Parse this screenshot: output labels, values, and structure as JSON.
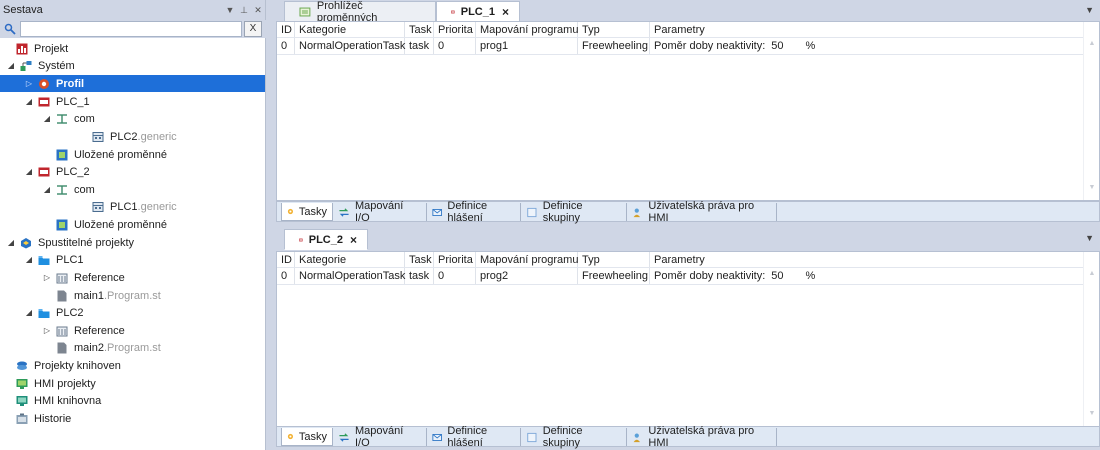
{
  "left_panel": {
    "title": "Sestava",
    "search_placeholder": "",
    "clear_label": "X",
    "tree": [
      {
        "label": "Projekt",
        "suffix": "",
        "icon": "project-icon"
      },
      {
        "label": "Systém",
        "suffix": "",
        "icon": "system-icon"
      },
      {
        "label": "Profil",
        "suffix": "",
        "icon": "profile-icon",
        "selected": true
      },
      {
        "label": "PLC_1",
        "suffix": "",
        "icon": "plc-icon"
      },
      {
        "label": "com",
        "suffix": "",
        "icon": "com-icon"
      },
      {
        "label": "PLC2",
        "suffix": ".generic",
        "icon": "device-icon"
      },
      {
        "label": "Uložené proměnné",
        "suffix": "",
        "icon": "saved-variables-icon"
      },
      {
        "label": "PLC_2",
        "suffix": "",
        "icon": "plc-icon"
      },
      {
        "label": "com",
        "suffix": "",
        "icon": "com-icon"
      },
      {
        "label": "PLC1",
        "suffix": ".generic",
        "icon": "device-icon"
      },
      {
        "label": "Uložené proměnné",
        "suffix": "",
        "icon": "saved-variables-icon"
      },
      {
        "label": "Spustitelné projekty",
        "suffix": "",
        "icon": "executable-projects-icon"
      },
      {
        "label": "PLC1",
        "suffix": "",
        "icon": "folder-icon"
      },
      {
        "label": "Reference",
        "suffix": "",
        "icon": "reference-icon"
      },
      {
        "label": "main1",
        "suffix": ".Program.st",
        "icon": "file-icon"
      },
      {
        "label": "PLC2",
        "suffix": "",
        "icon": "folder-icon"
      },
      {
        "label": "Reference",
        "suffix": "",
        "icon": "reference-icon"
      },
      {
        "label": "main2",
        "suffix": ".Program.st",
        "icon": "file-icon"
      },
      {
        "label": "Projekty knihoven",
        "suffix": "",
        "icon": "library-projects-icon"
      },
      {
        "label": "HMI projekty",
        "suffix": "",
        "icon": "hmi-projects-icon"
      },
      {
        "label": "HMI knihovna",
        "suffix": "",
        "icon": "hmi-library-icon"
      },
      {
        "label": "Historie",
        "suffix": "",
        "icon": "history-icon"
      }
    ]
  },
  "doc1": {
    "tabs": [
      {
        "label": "Prohlížeč proměnných",
        "close": ""
      },
      {
        "label": "PLC_1",
        "close": "×"
      }
    ],
    "columns": [
      "ID",
      "Kategorie",
      "Task",
      "Priorita",
      "Mapování programu",
      "Typ",
      "Parametry"
    ],
    "row": {
      "id": "0",
      "kategorie": "NormalOperationTask",
      "task": "task",
      "priorita": "0",
      "mapovani": "prog1",
      "typ": "Freewheeling",
      "param_label": "Poměr doby neaktivity:",
      "param_value": "50",
      "param_unit": "%"
    }
  },
  "doc2": {
    "tabs": [
      {
        "label": "PLC_2",
        "close": "×"
      }
    ],
    "columns": [
      "ID",
      "Kategorie",
      "Task",
      "Priorita",
      "Mapování programu",
      "Typ",
      "Parametry"
    ],
    "row": {
      "id": "0",
      "kategorie": "NormalOperationTask",
      "task": "task",
      "priorita": "0",
      "mapovani": "prog2",
      "typ": "Freewheeling",
      "param_label": "Poměr doby neaktivity:",
      "param_value": "50",
      "param_unit": "%"
    }
  },
  "bottom_tabs": [
    "Tasky",
    "Mapování I/O",
    "Definice hlášení",
    "Definice skupiny",
    "Uživatelská práva pro HMI"
  ]
}
